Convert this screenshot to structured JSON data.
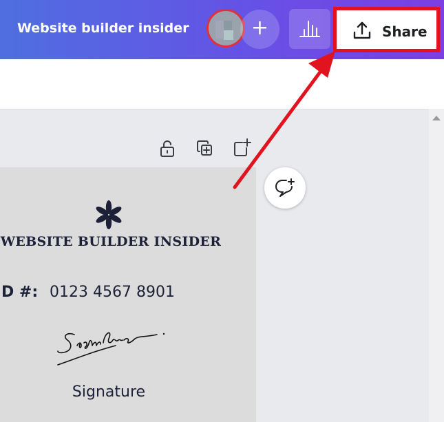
{
  "header": {
    "title": "Website builder insider",
    "add_label": "+",
    "share_label": "Share"
  },
  "document": {
    "brand_name": "WEBSITE BUILDER INSIDER",
    "id_label": "D #:",
    "id_value": "0123 4567 8901",
    "signature_script": "Signature",
    "signature_label": "Signature"
  },
  "icons": {
    "avatar": "user-avatar",
    "add": "plus-icon",
    "analytics": "bar-chart-icon",
    "share": "upload-icon",
    "lock": "unlock-icon",
    "duplicate": "duplicate-page-icon",
    "add_page": "add-page-icon",
    "comment": "add-comment-icon",
    "brand_mark": "asterisk-flower-icon"
  },
  "colors": {
    "header_gradient_start": "#4f6fe0",
    "header_gradient_end": "#7b3fe4",
    "highlight": "#e0131f",
    "text_dark": "#1c2138"
  }
}
